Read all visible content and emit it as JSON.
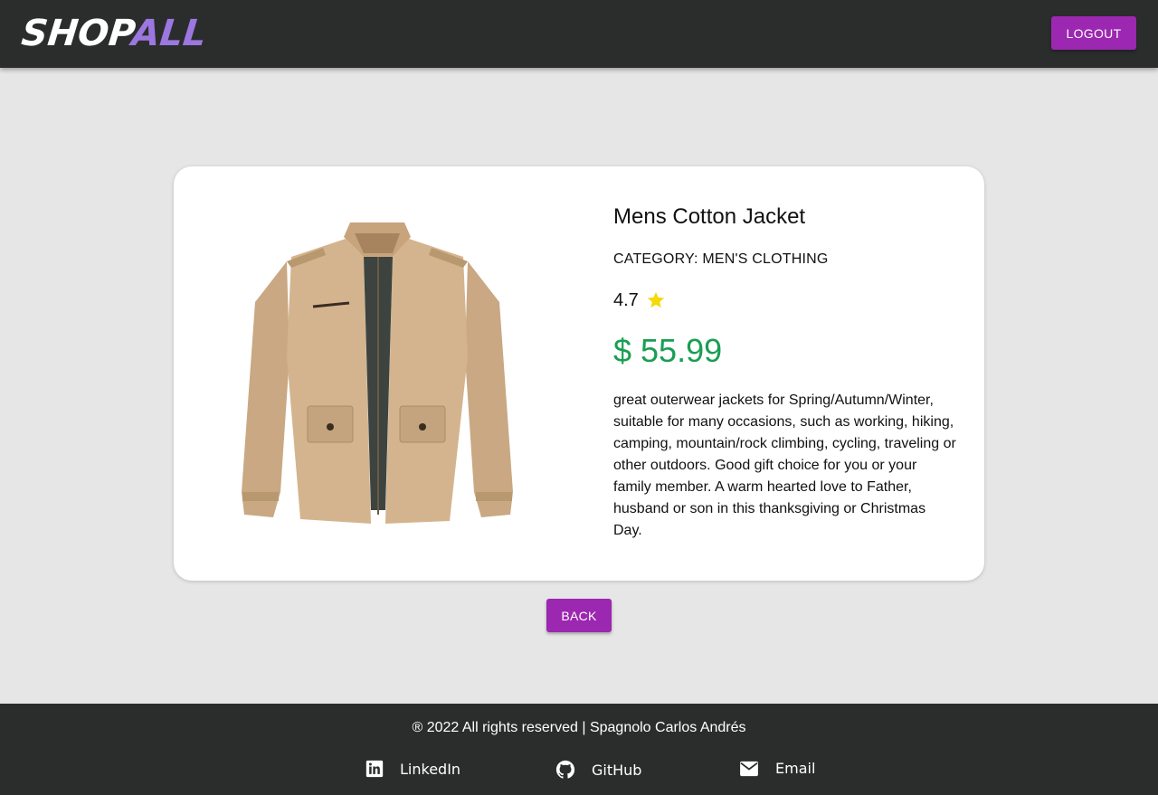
{
  "header": {
    "logo_part1": "SHOP",
    "logo_part2": "ALL",
    "logout_label": "LOGOUT"
  },
  "product": {
    "title": "Mens Cotton Jacket",
    "category": "CATEGORY: MEN'S CLOTHING",
    "rating": "4.7",
    "price": "$ 55.99",
    "description": "great outerwear jackets for Spring/Autumn/Winter, suitable for many occasions, such as working, hiking, camping, mountain/rock climbing, cycling, traveling or other outdoors. Good gift choice for you or your family member. A warm hearted love to Father, husband or son in this thanksgiving or Christmas Day."
  },
  "back_label": "BACK",
  "footer": {
    "copyright": "® 2022 All rights reserved | Spagnolo Carlos Andrés",
    "links": [
      {
        "label": "LinkedIn",
        "icon": "linkedin-icon"
      },
      {
        "label": "GitHub",
        "icon": "github-icon"
      },
      {
        "label": "Email",
        "icon": "email-icon"
      }
    ]
  },
  "colors": {
    "primary_button": "#9c27b0",
    "price": "#1a9e52",
    "star": "#f5d90a",
    "bar_background": "#2b2d2d",
    "logo_accent": "#9c77e0"
  }
}
